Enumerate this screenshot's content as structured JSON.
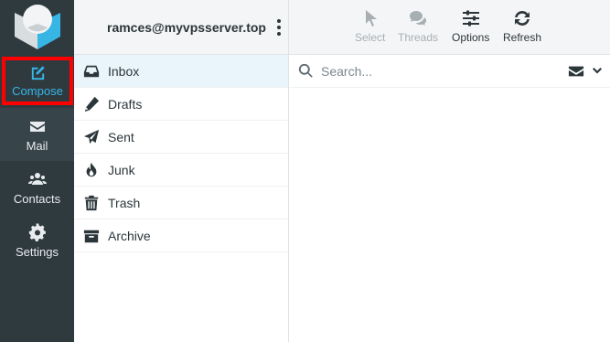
{
  "rail": {
    "compose": {
      "label": "Compose",
      "icon": "compose-icon"
    },
    "items": [
      {
        "label": "Mail",
        "icon": "envelope-icon"
      },
      {
        "label": "Contacts",
        "icon": "users-icon"
      },
      {
        "label": "Settings",
        "icon": "gear-icon"
      }
    ]
  },
  "folders": {
    "account": "ramces@myvpsserver.top",
    "items": [
      {
        "label": "Inbox",
        "icon": "inbox-icon"
      },
      {
        "label": "Drafts",
        "icon": "pencil-icon"
      },
      {
        "label": "Sent",
        "icon": "paper-plane-icon"
      },
      {
        "label": "Junk",
        "icon": "fire-icon"
      },
      {
        "label": "Trash",
        "icon": "trash-icon"
      },
      {
        "label": "Archive",
        "icon": "archive-icon"
      }
    ]
  },
  "toolbar": {
    "select": "Select",
    "threads": "Threads",
    "options": "Options",
    "refresh": "Refresh"
  },
  "search": {
    "placeholder": "Search..."
  },
  "colors": {
    "rail": "#2f3a3f",
    "accent": "#37b6e5",
    "highlight": "#ff0000"
  }
}
